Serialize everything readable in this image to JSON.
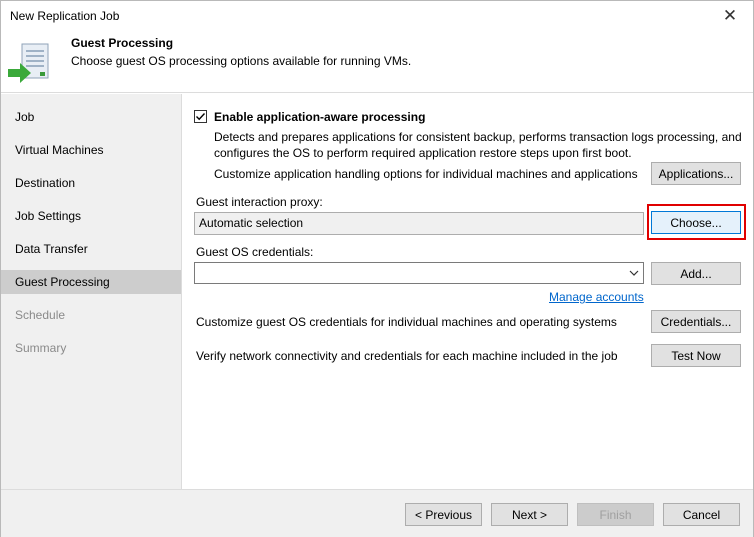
{
  "window": {
    "title": "New Replication Job",
    "close_glyph": "✕"
  },
  "header": {
    "title": "Guest Processing",
    "subtitle": "Choose guest OS processing options available for running VMs.",
    "icon": "replication-job-icon"
  },
  "sidebar": {
    "items": [
      {
        "label": "Job",
        "state": "normal"
      },
      {
        "label": "Virtual Machines",
        "state": "normal"
      },
      {
        "label": "Destination",
        "state": "normal"
      },
      {
        "label": "Job Settings",
        "state": "normal"
      },
      {
        "label": "Data Transfer",
        "state": "normal"
      },
      {
        "label": "Guest Processing",
        "state": "active"
      },
      {
        "label": "Schedule",
        "state": "disabled"
      },
      {
        "label": "Summary",
        "state": "disabled"
      }
    ]
  },
  "main": {
    "app_aware": {
      "checked": true,
      "label": "Enable application-aware processing",
      "description": "Detects and prepares applications for consistent backup, performs transaction logs processing, and configures the OS to perform required application restore steps upon first boot.",
      "customize_text": "Customize application handling options for individual machines and applications",
      "applications_button": "Applications..."
    },
    "proxy": {
      "label": "Guest interaction proxy:",
      "value": "Automatic selection",
      "choose_button": "Choose..."
    },
    "credentials": {
      "label": "Guest OS credentials:",
      "value": "",
      "add_button": "Add...",
      "manage_link": "Manage accounts"
    },
    "customize_creds": {
      "text": "Customize guest OS credentials for individual machines and operating systems",
      "button": "Credentials..."
    },
    "verify": {
      "text": "Verify network connectivity and credentials for each machine included in the job",
      "button": "Test Now"
    }
  },
  "footer": {
    "previous": "< Previous",
    "next": "Next >",
    "finish": "Finish",
    "cancel": "Cancel"
  },
  "colors": {
    "highlight": "#e00000",
    "link": "#0066cc",
    "active_nav": "#cdcdcd"
  }
}
